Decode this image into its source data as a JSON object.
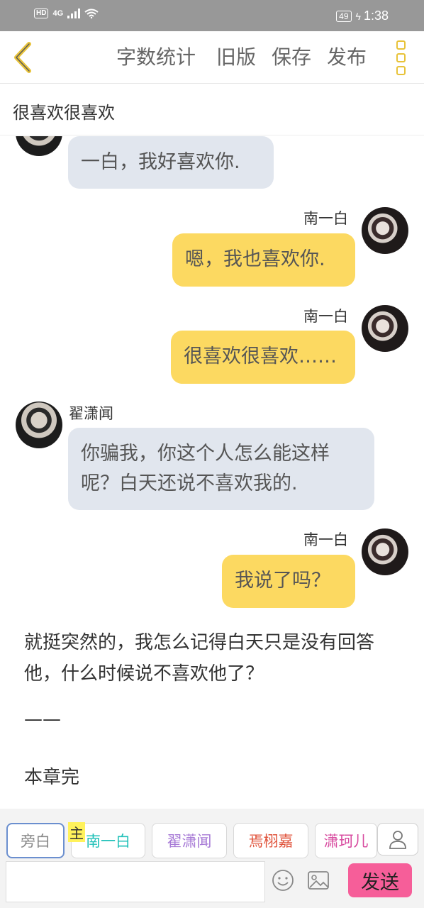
{
  "status_bar": {
    "hd": "HD",
    "network": "4G",
    "battery": "49",
    "time": "1:38"
  },
  "toolbar": {
    "word_count": "字数统计",
    "old_version": "旧版",
    "save": "保存",
    "publish": "发布"
  },
  "chapter": {
    "title": "很喜欢很喜欢"
  },
  "messages": [
    {
      "speaker": "",
      "side": "left",
      "text": "一白，我好喜欢你."
    },
    {
      "speaker": "南一白",
      "side": "right",
      "text": "嗯，我也喜欢你."
    },
    {
      "speaker": "南一白",
      "side": "right",
      "text": "很喜欢很喜欢……"
    },
    {
      "speaker": "翟潇闻",
      "side": "left",
      "text": "你骗我，你这个人怎么能这样呢？白天还说不喜欢我的."
    },
    {
      "speaker": "南一白",
      "side": "right",
      "text": "我说了吗？"
    }
  ],
  "narration": [
    "就挺突然的，我怎么记得白天只是没有回答他，什么时候说不喜欢他了？",
    "——",
    "本章完"
  ],
  "bottom": {
    "tabs": [
      {
        "label": "旁白",
        "color": "#888888"
      },
      {
        "label": "南一白",
        "color": "#22c1b9"
      },
      {
        "label": "翟潇闻",
        "color": "#a77ad6"
      },
      {
        "label": "焉栩嘉",
        "color": "#e0533b"
      },
      {
        "label": "潇珂儿",
        "color": "#d84ca0"
      }
    ],
    "main_badge": "主",
    "input_placeholder": "",
    "send": "发送"
  },
  "colors": {
    "left_bubble": "#e1e6ee",
    "right_bubble": "#fcd961",
    "send_button": "#f65e99",
    "accent_yellow": "#e8c33a"
  }
}
